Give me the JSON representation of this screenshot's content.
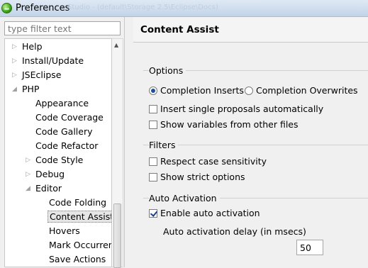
{
  "window": {
    "title": "Preferences",
    "ghost_title": "Studio - (default\\Storage 2.5\\Eclipse\\Docs)"
  },
  "filter": {
    "placeholder": "type filter text"
  },
  "tree": {
    "items": [
      {
        "label": "Help",
        "expander": "▷"
      },
      {
        "label": "Install/Update",
        "expander": "▷"
      },
      {
        "label": "JSEclipse",
        "expander": "▷"
      },
      {
        "label": "PHP",
        "expander": "◢"
      },
      {
        "label": "Appearance",
        "expander": ""
      },
      {
        "label": "Code Coverage",
        "expander": ""
      },
      {
        "label": "Code Gallery",
        "expander": ""
      },
      {
        "label": "Code Refactor",
        "expander": ""
      },
      {
        "label": "Code Style",
        "expander": "▷"
      },
      {
        "label": "Debug",
        "expander": "▷"
      },
      {
        "label": "Editor",
        "expander": "◢"
      },
      {
        "label": "Code Folding",
        "expander": ""
      },
      {
        "label": "Content Assist",
        "expander": ""
      },
      {
        "label": "Hovers",
        "expander": ""
      },
      {
        "label": "Mark Occurrences",
        "expander": ""
      },
      {
        "label": "Save Actions",
        "expander": ""
      }
    ],
    "selected": "Content Assist"
  },
  "page": {
    "title": "Content Assist",
    "options": {
      "title": "Options",
      "radio_inserts": "Completion Inserts",
      "radio_overwrites": "Completion Overwrites",
      "single_proposals": "Insert single proposals automatically",
      "show_variables": "Show variables from other files"
    },
    "filters": {
      "title": "Filters",
      "case_sensitivity": "Respect case sensitivity",
      "strict_options": "Show strict options"
    },
    "auto_activation": {
      "title": "Auto Activation",
      "enable": "Enable auto activation",
      "delay_label": "Auto activation delay (in msecs)",
      "delay_value": "50"
    }
  },
  "state": {
    "completion_mode": "Completion Inserts",
    "single_proposals": false,
    "show_variables": false,
    "case_sensitivity": false,
    "strict_options": false,
    "enable_auto_activation": true
  },
  "colors": {
    "accent": "#1e4f9e",
    "titlebar": "#c3d4e8"
  }
}
